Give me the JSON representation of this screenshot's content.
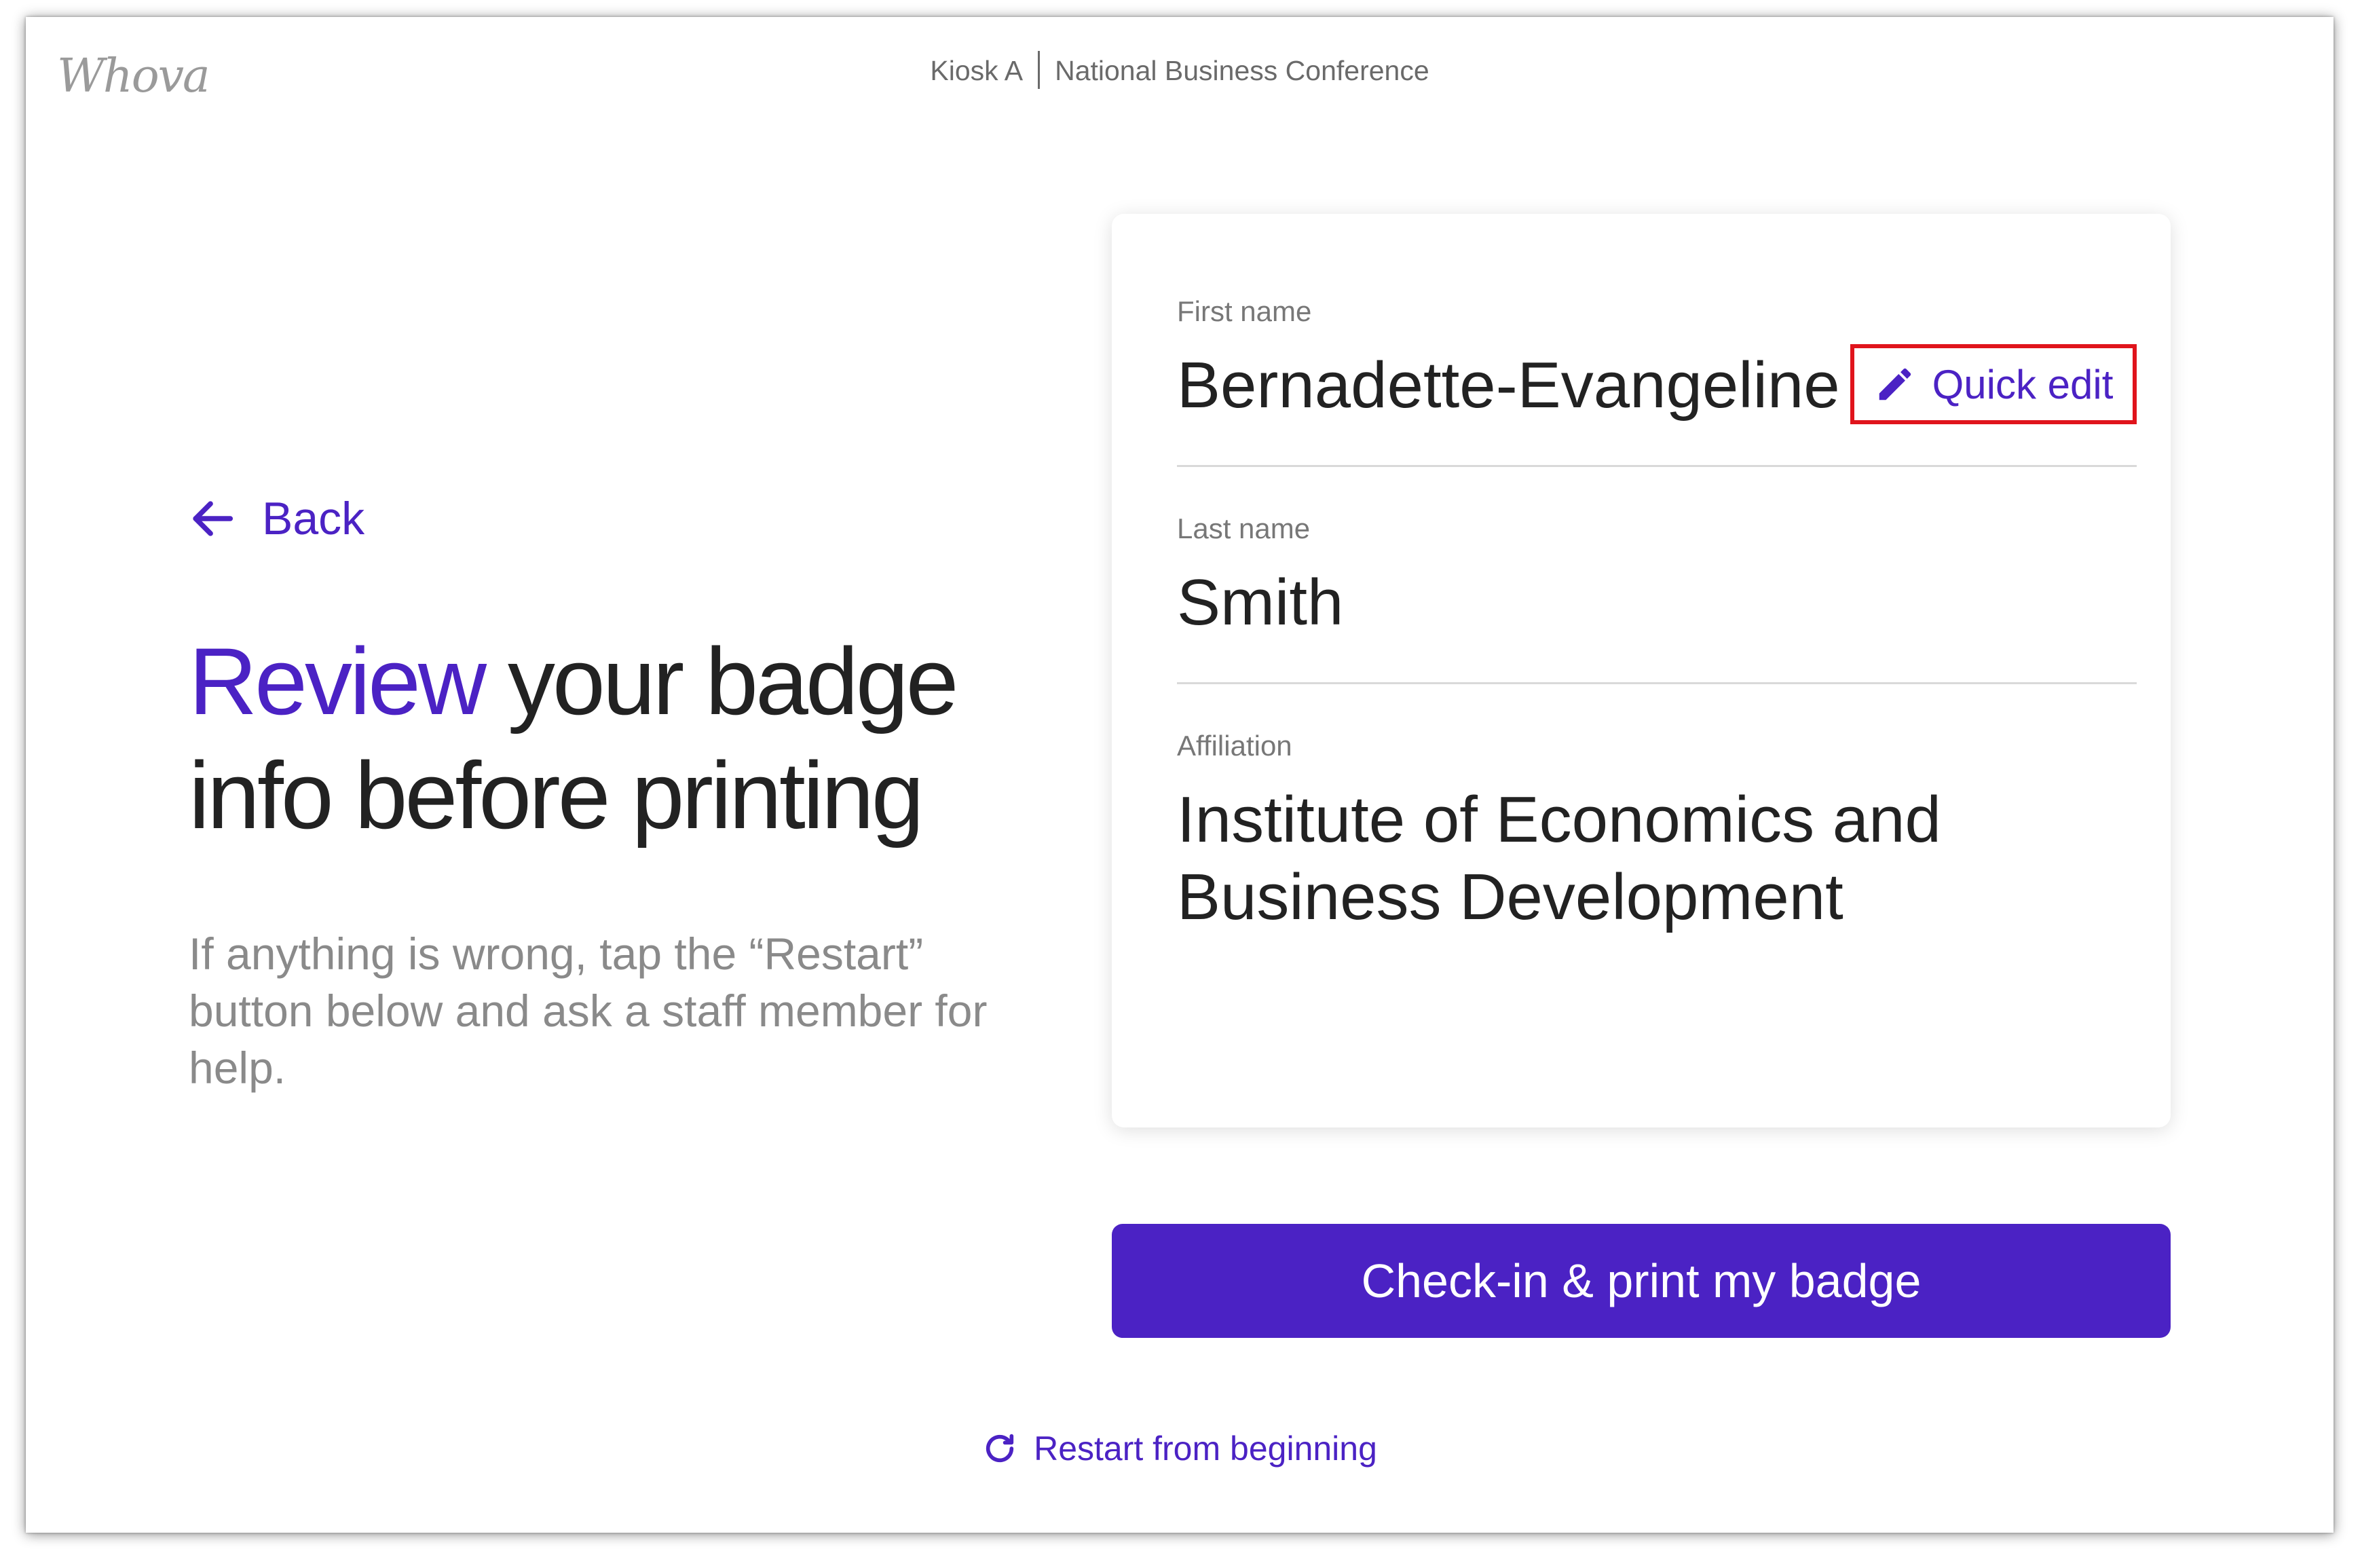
{
  "app": {
    "logo": "Whova",
    "kiosk": "Kiosk A",
    "event": "National Business Conference"
  },
  "nav": {
    "back_label": "Back"
  },
  "intro": {
    "title_accent": "Review",
    "title_rest": " your badge info before printing",
    "subtitle": "If anything is wrong, tap the “Restart” button below and ask a staff member for help."
  },
  "badge": {
    "first_name_label": "First name",
    "first_name": "Bernadette-Evangeline",
    "quick_edit_label": "Quick edit",
    "last_name_label": "Last name",
    "last_name": "Smith",
    "affiliation_label": "Affiliation",
    "affiliation": "Institute of Economics and Business Development"
  },
  "actions": {
    "checkin_label": "Check-in & print my badge",
    "restart_label": "Restart from beginning"
  },
  "colors": {
    "accent": "#4b22c4",
    "highlight_border": "#e0141c"
  },
  "icons": {
    "back": "arrow-left-icon",
    "edit": "pencil-icon",
    "restart": "refresh-icon"
  }
}
